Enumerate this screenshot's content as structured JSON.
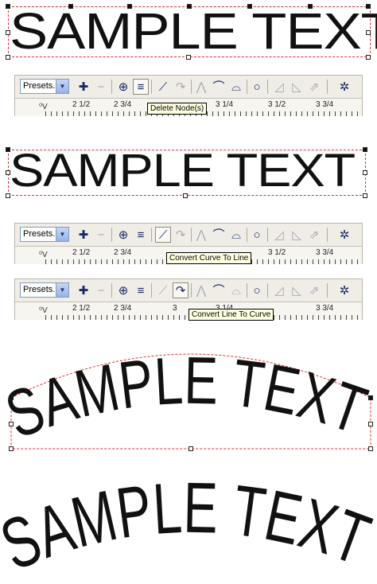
{
  "sample_text": "SAMPLE TEXT",
  "toolbar": {
    "presets_label": "Presets..",
    "presets_arrow": "▼",
    "ruler_corner": "⁰V",
    "ruler_labels": [
      "2 1/2",
      "2 3/4",
      "3",
      "3 1/4",
      "3 1/2",
      "3 3/4"
    ]
  },
  "tooltips": {
    "delete_nodes": "Delete Node(s)",
    "convert_curve_to_line": "Convert Curve To Line",
    "convert_line_to_curve": "Convert Line To Curve"
  },
  "icons": {
    "add_node": "✚",
    "delete_node": "−",
    "join_nodes": "⊕",
    "break_curve": "≡",
    "to_line": "⟋",
    "to_curve": "↷",
    "cusp": "⋀",
    "smooth": "⌒",
    "symmetric": "⌓",
    "close_curve": "○",
    "stretch": "◿",
    "rotate": "◺",
    "align": "⇗",
    "options": "✲"
  },
  "colors": {
    "bbox": "#e03030",
    "toolbar": "#efede6",
    "tooltip": "#ffffe1"
  }
}
